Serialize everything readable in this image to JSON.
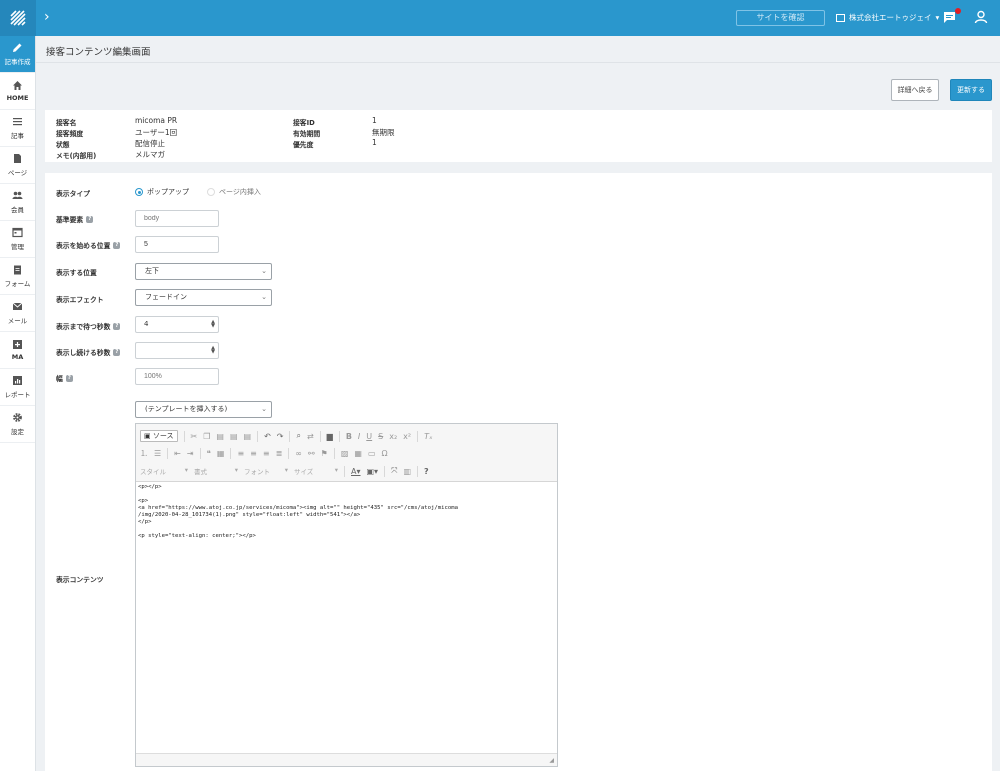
{
  "topbar": {
    "site_button": "サイトを確認",
    "company": "株式会社エートゥジェイ",
    "colors": {
      "bar": "#2a97cd",
      "notification": "#e21e25"
    }
  },
  "sidebar": {
    "items": [
      {
        "label": "記事作成",
        "icon": "pencil-icon"
      },
      {
        "label": "HOME",
        "icon": "home-icon"
      },
      {
        "label": "記事",
        "icon": "list-icon"
      },
      {
        "label": "ページ",
        "icon": "document-icon"
      },
      {
        "label": "会員",
        "icon": "users-icon"
      },
      {
        "label": "管理",
        "icon": "grid-icon"
      },
      {
        "label": "フォーム",
        "icon": "clipboard-icon"
      },
      {
        "label": "メール",
        "icon": "mail-icon"
      },
      {
        "label": "MA",
        "icon": "plus-square-icon"
      },
      {
        "label": "レポート",
        "icon": "bar-chart-icon"
      },
      {
        "label": "設定",
        "icon": "gear-icon"
      }
    ]
  },
  "page": {
    "title": "接客コンテンツ編集画面",
    "back_button": "詳細へ戻る",
    "update_button": "更新する"
  },
  "info": {
    "name_label": "接客名",
    "name_value": "micoma PR",
    "freq_label": "接客頻度",
    "freq_value": "ユーザー1回",
    "status_label": "状態",
    "status_value": "配信停止",
    "memo_label": "メモ(内部用)",
    "memo_value": "メルマガ",
    "id_label": "接客ID",
    "id_value": "1",
    "period_label": "有効期間",
    "period_value": "無期限",
    "priority_label": "優先度",
    "priority_value": "1"
  },
  "form": {
    "display_type_label": "表示タイプ",
    "display_type_options": [
      "ポップアップ",
      "ページ内挿入"
    ],
    "base_element_label": "基準要素",
    "base_element_placeholder": "body",
    "start_position_label": "表示を始める位置",
    "start_position_value": "5",
    "position_label": "表示する位置",
    "position_value": "左下",
    "effect_label": "表示エフェクト",
    "effect_value": "フェードイン",
    "wait_label": "表示まで待つ秒数",
    "wait_value": "4",
    "duration_label": "表示し続ける秒数",
    "duration_value": "",
    "width_label": "幅",
    "width_placeholder": "100%",
    "template_value": "(テンプレートを挿入する)",
    "content_label": "表示コンテンツ",
    "help_symbol": "?"
  },
  "editor": {
    "source_button": "ソース",
    "style_combo": "スタイル",
    "format_combo": "書式",
    "font_combo": "フォント",
    "size_combo": "サイズ",
    "code": "<p></p>\n\n<p>\n<a href=\"https://www.atoj.co.jp/services/micoma\"><img alt=\"\" height=\"435\" src=\"/cms/atoj/micoma\n/img/2020-04-28_101734(1).png\" style=\"float:left\" width=\"541\"></a>\n</p>\n\n<p style=\"text-align: center;\"></p>"
  }
}
